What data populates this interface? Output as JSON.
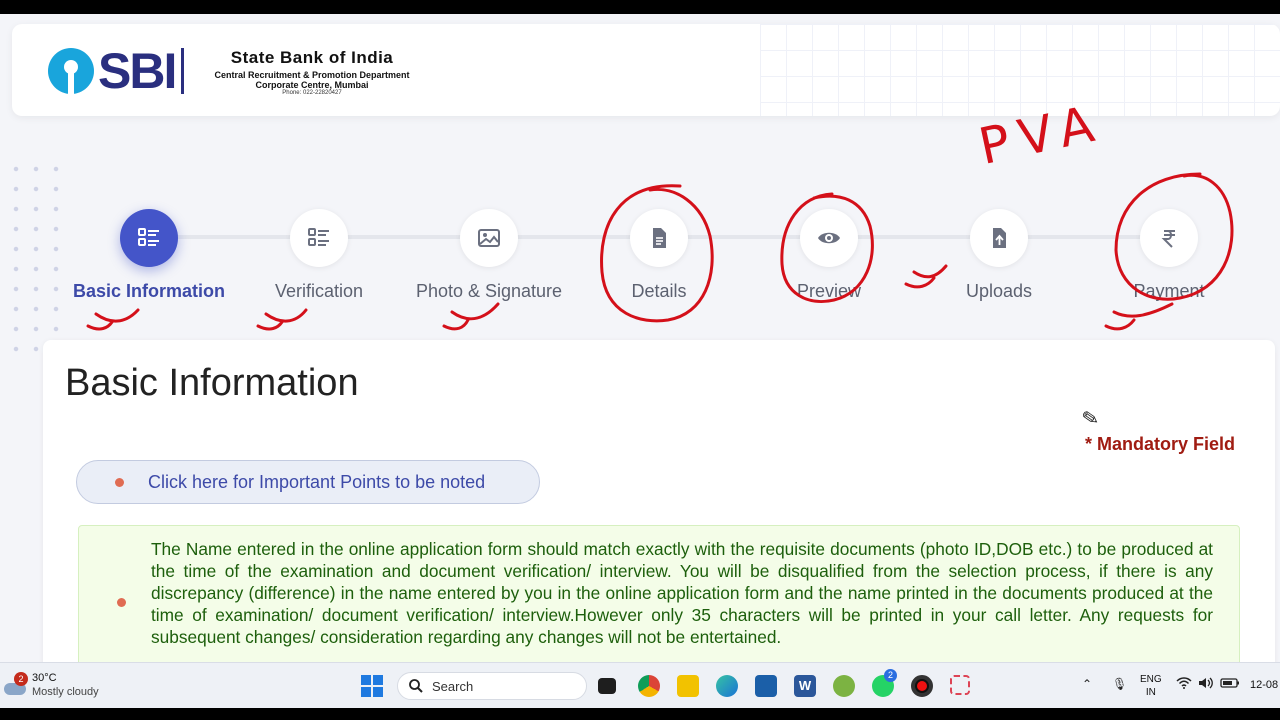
{
  "header": {
    "logo_text": "SBI",
    "bank_name": "State Bank of India",
    "department": "Central Recruitment & Promotion Department",
    "corporate": "Corporate Centre, Mumbai",
    "phone": "Phone: 022-22820427"
  },
  "steps": [
    {
      "label": "Basic Information",
      "icon": "checklist-icon",
      "active": true
    },
    {
      "label": "Verification",
      "icon": "checklist-icon",
      "active": false
    },
    {
      "label": "Photo & Signature",
      "icon": "image-icon",
      "active": false
    },
    {
      "label": "Details",
      "icon": "document-icon",
      "active": false
    },
    {
      "label": "Preview",
      "icon": "eye-icon",
      "active": false
    },
    {
      "label": "Uploads",
      "icon": "upload-icon",
      "active": false
    },
    {
      "label": "Payment",
      "icon": "rupee-icon",
      "active": false
    }
  ],
  "main": {
    "title": "Basic Information",
    "mandatory": "* Mandatory Field",
    "points_button": "Click here for Important Points to be noted",
    "notice": "The Name entered in the online application form should match exactly with the requisite documents (photo ID,DOB etc.) to be produced at the time of the examination and document verification/ interview. You will be disqualified from the selection process, if there is any discrepancy (difference) in the name entered by you in the online application form and the name printed in the documents produced at the time of examination/ document verification/ interview.However only 35 characters will be printed in your call letter. Any requests for subsequent changes/ consideration regarding any changes will not be entertained."
  },
  "annotation": {
    "handwriting": "PVA",
    "ink_color": "#d4101a"
  },
  "taskbar": {
    "weather_badge": "2",
    "temperature": "30°C",
    "weather": "Mostly cloudy",
    "search_label": "Search",
    "whatsapp_badge": "2",
    "lang_top": "ENG",
    "lang_bottom": "IN",
    "clock": "12-08"
  }
}
